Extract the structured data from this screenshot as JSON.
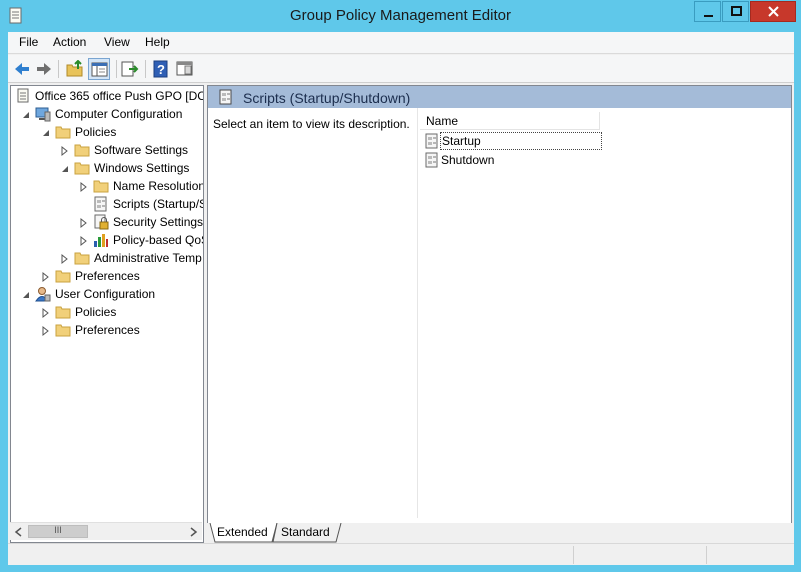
{
  "window": {
    "title": "Group Policy Management Editor"
  },
  "menu": [
    "File",
    "Action",
    "View",
    "Help"
  ],
  "tree": [
    {
      "label": "Office 365 office Push GPO [DC"
    },
    {
      "label": "Computer Configuration"
    },
    {
      "label": "Policies"
    },
    {
      "label": "Software Settings"
    },
    {
      "label": "Windows Settings"
    },
    {
      "label": "Name Resolution"
    },
    {
      "label": "Scripts (Startup/S"
    },
    {
      "label": "Security Settings"
    },
    {
      "label": "Policy-based QoS"
    },
    {
      "label": "Administrative Temp"
    },
    {
      "label": "Preferences"
    },
    {
      "label": "User Configuration"
    },
    {
      "label": "Policies"
    },
    {
      "label": "Preferences"
    }
  ],
  "right": {
    "header": "Scripts (Startup/Shutdown)",
    "description": "Select an item to view its description.",
    "column": "Name",
    "items": [
      "Startup",
      "Shutdown"
    ]
  },
  "tabs": [
    "Extended",
    "Standard"
  ],
  "scroll_glyph": "III"
}
